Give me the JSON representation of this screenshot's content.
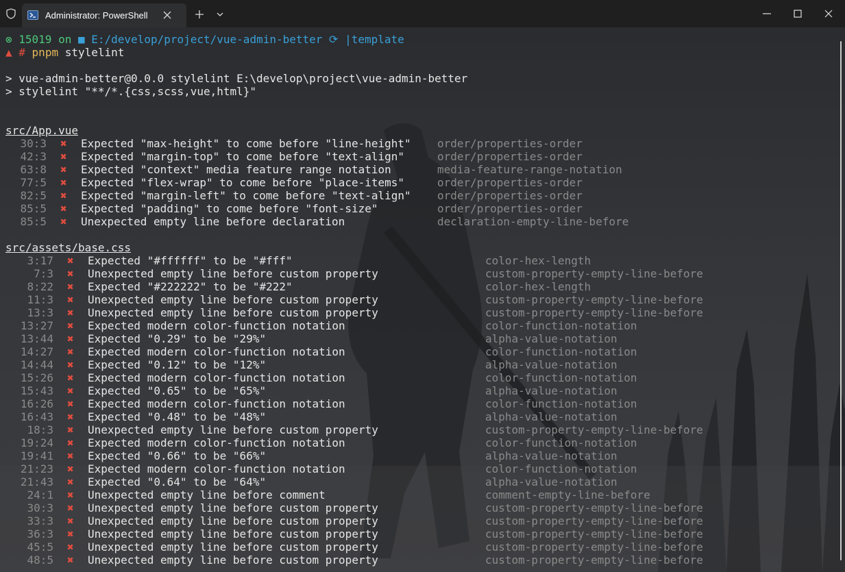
{
  "window": {
    "tab_title": "Administrator: PowerShell"
  },
  "prompt": {
    "pid": "15019",
    "on": "on",
    "path": "E:/develop/project/vue-admin-better",
    "branch": "template",
    "symbol": "#",
    "command_bin": "pnpm",
    "command_arg": "stylelint"
  },
  "output": {
    "line1": "> vue-admin-better@0.0.0 stylelint E:\\develop\\project\\vue-admin-better",
    "line2": "> stylelint \"**/*.{css,scss,vue,html}\""
  },
  "files": [
    {
      "name": "src/App.vue",
      "issues": [
        {
          "loc": "30:3",
          "msg": "Expected \"max-height\" to come before \"line-height\"",
          "rule": "order/properties-order"
        },
        {
          "loc": "42:3",
          "msg": "Expected \"margin-top\" to come before \"text-align\"",
          "rule": "order/properties-order"
        },
        {
          "loc": "63:8",
          "msg": "Expected \"context\" media feature range notation",
          "rule": "media-feature-range-notation"
        },
        {
          "loc": "77:5",
          "msg": "Expected \"flex-wrap\" to come before \"place-items\"",
          "rule": "order/properties-order"
        },
        {
          "loc": "82:5",
          "msg": "Expected \"margin-left\" to come before \"text-align\"",
          "rule": "order/properties-order"
        },
        {
          "loc": "85:5",
          "msg": "Expected \"padding\" to come before \"font-size\"",
          "rule": "order/properties-order"
        },
        {
          "loc": "85:5",
          "msg": "Unexpected empty line before declaration",
          "rule": "declaration-empty-line-before"
        }
      ]
    },
    {
      "name": "src/assets/base.css",
      "issues": [
        {
          "loc": "3:17",
          "msg": "Expected \"#ffffff\" to be \"#fff\"",
          "rule": "color-hex-length"
        },
        {
          "loc": "7:3",
          "msg": "Unexpected empty line before custom property",
          "rule": "custom-property-empty-line-before"
        },
        {
          "loc": "8:22",
          "msg": "Expected \"#222222\" to be \"#222\"",
          "rule": "color-hex-length"
        },
        {
          "loc": "11:3",
          "msg": "Unexpected empty line before custom property",
          "rule": "custom-property-empty-line-before"
        },
        {
          "loc": "13:3",
          "msg": "Unexpected empty line before custom property",
          "rule": "custom-property-empty-line-before"
        },
        {
          "loc": "13:27",
          "msg": "Expected modern color-function notation",
          "rule": "color-function-notation"
        },
        {
          "loc": "13:44",
          "msg": "Expected \"0.29\" to be \"29%\"",
          "rule": "alpha-value-notation"
        },
        {
          "loc": "14:27",
          "msg": "Expected modern color-function notation",
          "rule": "color-function-notation"
        },
        {
          "loc": "14:44",
          "msg": "Expected \"0.12\" to be \"12%\"",
          "rule": "alpha-value-notation"
        },
        {
          "loc": "15:26",
          "msg": "Expected modern color-function notation",
          "rule": "color-function-notation"
        },
        {
          "loc": "15:43",
          "msg": "Expected \"0.65\" to be \"65%\"",
          "rule": "alpha-value-notation"
        },
        {
          "loc": "16:26",
          "msg": "Expected modern color-function notation",
          "rule": "color-function-notation"
        },
        {
          "loc": "16:43",
          "msg": "Expected \"0.48\" to be \"48%\"",
          "rule": "alpha-value-notation"
        },
        {
          "loc": "18:3",
          "msg": "Unexpected empty line before custom property",
          "rule": "custom-property-empty-line-before"
        },
        {
          "loc": "19:24",
          "msg": "Expected modern color-function notation",
          "rule": "color-function-notation"
        },
        {
          "loc": "19:41",
          "msg": "Expected \"0.66\" to be \"66%\"",
          "rule": "alpha-value-notation"
        },
        {
          "loc": "21:23",
          "msg": "Expected modern color-function notation",
          "rule": "color-function-notation"
        },
        {
          "loc": "21:43",
          "msg": "Expected \"0.64\" to be \"64%\"",
          "rule": "alpha-value-notation"
        },
        {
          "loc": "24:1",
          "msg": "Unexpected empty line before comment",
          "rule": "comment-empty-line-before"
        },
        {
          "loc": "30:3",
          "msg": "Unexpected empty line before custom property",
          "rule": "custom-property-empty-line-before"
        },
        {
          "loc": "33:3",
          "msg": "Unexpected empty line before custom property",
          "rule": "custom-property-empty-line-before"
        },
        {
          "loc": "36:3",
          "msg": "Unexpected empty line before custom property",
          "rule": "custom-property-empty-line-before"
        },
        {
          "loc": "45:5",
          "msg": "Unexpected empty line before custom property",
          "rule": "custom-property-empty-line-before"
        },
        {
          "loc": "48:5",
          "msg": "Unexpected empty line before custom property",
          "rule": "custom-property-empty-line-before"
        }
      ]
    }
  ],
  "error_mark": "✖",
  "colors": {
    "prompt_green": "#4ec77a",
    "path_blue": "#3aa0d8",
    "error_red": "#e04d3f",
    "rule_gray": "#8a8a8a"
  }
}
